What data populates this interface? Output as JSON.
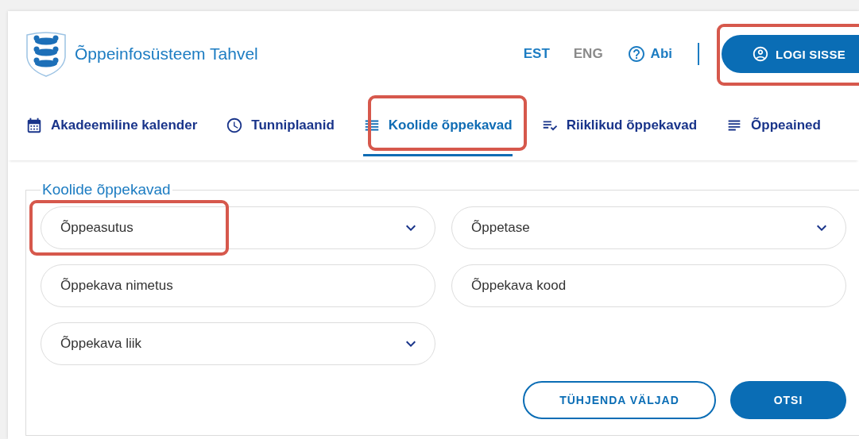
{
  "header": {
    "title": "Õppeinfosüsteem Tahvel",
    "languages": [
      {
        "label": "EST",
        "selected": true
      },
      {
        "label": "ENG",
        "selected": false
      }
    ],
    "help": "Abi",
    "login": {
      "label": "LOGI SISSE",
      "highlighted": true
    }
  },
  "tabs": [
    {
      "label": "Akadeemiline kalender",
      "kind": "calendar",
      "selected": false,
      "highlighted": false
    },
    {
      "label": "Tunniplaanid",
      "kind": "clock",
      "selected": false,
      "highlighted": false
    },
    {
      "label": "Koolide õppekavad",
      "kind": "list",
      "selected": true,
      "highlighted": true
    },
    {
      "label": "Riiklikud õppekavad",
      "kind": "listcheck",
      "selected": false,
      "highlighted": false
    },
    {
      "label": "Õppeained",
      "kind": "lines",
      "selected": false,
      "highlighted": false
    }
  ],
  "form": {
    "legend": "Koolide õppekavad",
    "fields": [
      {
        "kind": "select",
        "placeholder": "Õppeasutus",
        "highlighted": true
      },
      {
        "kind": "select",
        "placeholder": "Õppetase",
        "highlighted": false
      },
      {
        "kind": "text",
        "placeholder": "Õppekava nimetus",
        "highlighted": false
      },
      {
        "kind": "text",
        "placeholder": "Õppekava kood",
        "highlighted": false
      },
      {
        "kind": "select",
        "placeholder": "Õppekava liik",
        "highlighted": false
      }
    ],
    "buttons": [
      {
        "kind": "outline",
        "label": "TÜHJENDA VÄLJAD"
      },
      {
        "kind": "primary",
        "label": "OTSI"
      }
    ]
  }
}
